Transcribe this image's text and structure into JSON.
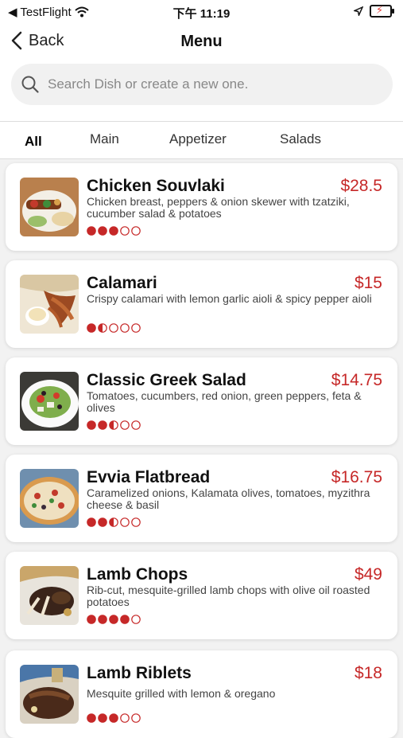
{
  "status": {
    "carrier": "◀ TestFlight",
    "time": "下午 11:19"
  },
  "nav": {
    "back_label": "Back",
    "title": "Menu"
  },
  "search": {
    "placeholder": "Search Dish or create a new one."
  },
  "tabs": [
    {
      "label": "All",
      "active": true
    },
    {
      "label": "Main",
      "active": false
    },
    {
      "label": "Appetizer",
      "active": false
    },
    {
      "label": "Salads",
      "active": false
    }
  ],
  "accent_color": "#c62828",
  "dishes": [
    {
      "name": "Chicken Souvlaki",
      "price": "$28.5",
      "description": "Chicken breast, peppers & onion skewer with tzatziki, cucumber salad & potatoes",
      "rating": 3,
      "image": "souvlaki-photo"
    },
    {
      "name": "Calamari",
      "price": "$15",
      "description": "Crispy calamari with lemon garlic aioli & spicy pepper aioli",
      "rating": 1.5,
      "image": "calamari-photo"
    },
    {
      "name": "Classic Greek Salad",
      "price": "$14.75",
      "description": "Tomatoes, cucumbers, red onion, green peppers, feta & olives",
      "rating": 2.5,
      "image": "greek-salad-photo"
    },
    {
      "name": "Evvia Flatbread",
      "price": "$16.75",
      "description": "Caramelized onions, Kalamata olives, tomatoes, myzithra cheese & basil",
      "rating": 2.5,
      "image": "flatbread-photo"
    },
    {
      "name": "Lamb Chops",
      "price": "$49",
      "description": "Rib-cut, mesquite-grilled lamb chops with olive oil roasted potatoes",
      "rating": 4,
      "image": "lamb-chops-photo"
    },
    {
      "name": "Lamb Riblets",
      "price": "$18",
      "description": "Mesquite grilled with lemon & oregano",
      "rating": 3,
      "image": "lamb-riblets-photo"
    }
  ]
}
